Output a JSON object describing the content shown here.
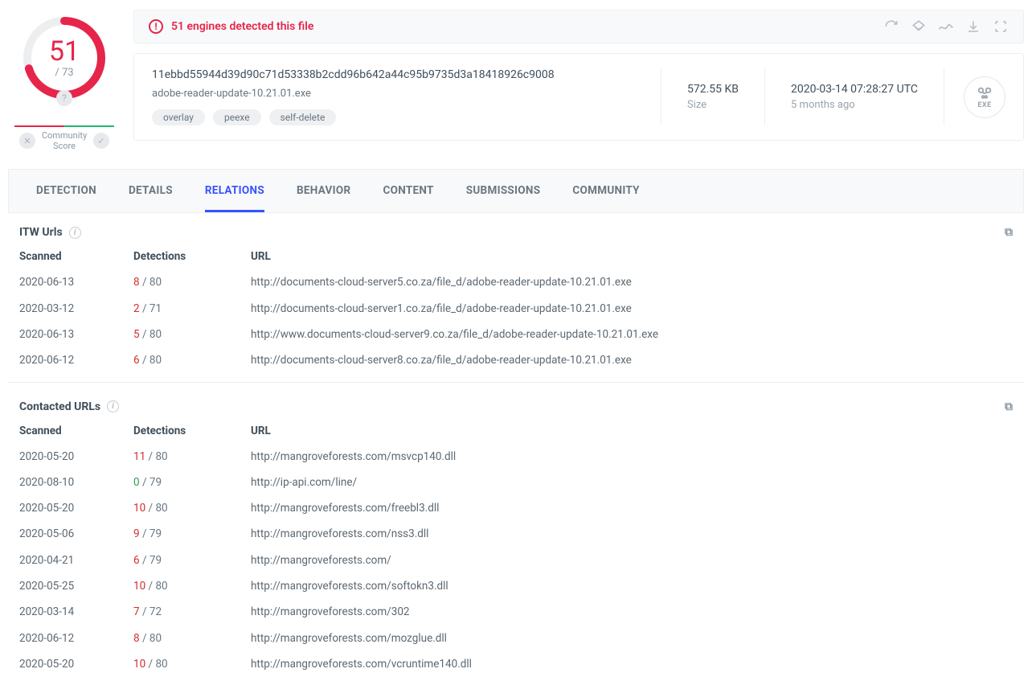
{
  "score": {
    "detected": 51,
    "total": "/ 73"
  },
  "community": {
    "label": "Community Score",
    "help": "?",
    "x": "✕",
    "check": "✓"
  },
  "alert": {
    "text": "51 engines detected this file",
    "bang": "!"
  },
  "info": {
    "hash": "11ebbd55944d39d90c71d53338b2cdd96b642a44c95b9735d3a18418926c9008",
    "filename": "adobe-reader-update-10.21.01.exe",
    "tags": [
      "overlay",
      "peexe",
      "self-delete"
    ],
    "size_val": "572.55 KB",
    "size_lbl": "Size",
    "date_val": "2020-03-14 07:28:27 UTC",
    "date_lbl": "5 months ago",
    "filetype": "EXE"
  },
  "tabs": [
    "DETECTION",
    "DETAILS",
    "RELATIONS",
    "BEHAVIOR",
    "CONTENT",
    "SUBMISSIONS",
    "COMMUNITY"
  ],
  "sections": {
    "itw": {
      "title": "ITW Urls",
      "headers": {
        "scanned": "Scanned",
        "det": "Detections",
        "url": "URL"
      },
      "rows": [
        {
          "scanned": "2020-06-13",
          "dn": "8",
          "dt": " / 80",
          "url": "http://documents-cloud-server5.co.za/file_d/adobe-reader-update-10.21.01.exe"
        },
        {
          "scanned": "2020-03-12",
          "dn": "2",
          "dt": " / 71",
          "url": "http://documents-cloud-server1.co.za/file_d/adobe-reader-update-10.21.01.exe"
        },
        {
          "scanned": "2020-06-13",
          "dn": "5",
          "dt": " / 80",
          "url": "http://www.documents-cloud-server9.co.za/file_d/adobe-reader-update-10.21.01.exe"
        },
        {
          "scanned": "2020-06-12",
          "dn": "6",
          "dt": " / 80",
          "url": "http://documents-cloud-server8.co.za/file_d/adobe-reader-update-10.21.01.exe"
        }
      ]
    },
    "contacted": {
      "title": "Contacted URLs",
      "headers": {
        "scanned": "Scanned",
        "det": "Detections",
        "url": "URL"
      },
      "rows": [
        {
          "scanned": "2020-05-20",
          "dn": "11",
          "dt": " / 80",
          "url": "http://mangroveforests.com/msvcp140.dll"
        },
        {
          "scanned": "2020-08-10",
          "dn": "0",
          "dt": " / 79",
          "url": "http://ip-api.com/line/",
          "green": true
        },
        {
          "scanned": "2020-05-20",
          "dn": "10",
          "dt": " / 80",
          "url": "http://mangroveforests.com/freebl3.dll"
        },
        {
          "scanned": "2020-05-06",
          "dn": "9",
          "dt": " / 79",
          "url": "http://mangroveforests.com/nss3.dll"
        },
        {
          "scanned": "2020-04-21",
          "dn": "6",
          "dt": " / 79",
          "url": "http://mangroveforests.com/"
        },
        {
          "scanned": "2020-05-25",
          "dn": "10",
          "dt": " / 80",
          "url": "http://mangroveforests.com/softokn3.dll"
        },
        {
          "scanned": "2020-03-14",
          "dn": "7",
          "dt": " / 72",
          "url": "http://mangroveforests.com/302"
        },
        {
          "scanned": "2020-06-12",
          "dn": "8",
          "dt": " / 80",
          "url": "http://mangroveforests.com/mozglue.dll"
        },
        {
          "scanned": "2020-05-20",
          "dn": "10",
          "dt": " / 80",
          "url": "http://mangroveforests.com/vcruntime140.dll"
        }
      ]
    }
  },
  "icons": {
    "info": "i",
    "copy": "⧉"
  }
}
